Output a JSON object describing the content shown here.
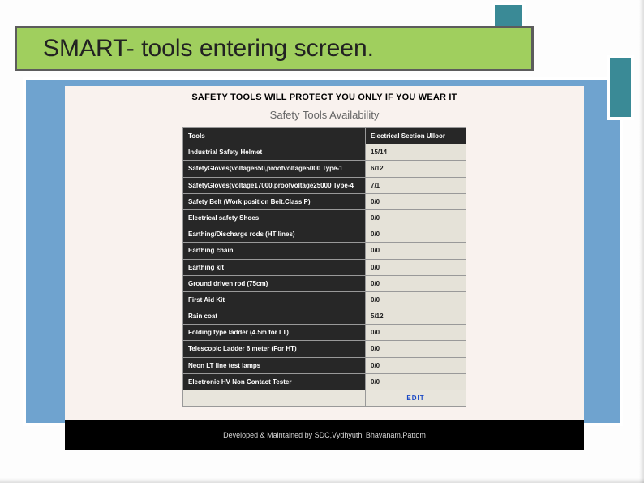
{
  "title": "SMART- tools entering screen.",
  "banner": "SAFETY TOOLS WILL PROTECT YOU ONLY IF YOU WEAR IT",
  "subhead": "Safety Tools Availability",
  "header": {
    "tools": "Tools",
    "section": "Electrical Section Ulloor"
  },
  "rows": [
    {
      "tool": "Industrial Safety Helmet",
      "val": "15/14"
    },
    {
      "tool": "SafetyGloves(voltage650,proofvoltage5000 Type-1",
      "val": "6/12"
    },
    {
      "tool": "SafetyGloves(voltage17000,proofvoltage25000 Type-4",
      "val": "7/1"
    },
    {
      "tool": "Safety Belt (Work position Belt.Class P)",
      "val": "0/0"
    },
    {
      "tool": "Electrical safety Shoes",
      "val": "0/0"
    },
    {
      "tool": "Earthing/Discharge rods (HT lines)",
      "val": "0/0"
    },
    {
      "tool": "Earthing chain",
      "val": "0/0"
    },
    {
      "tool": "Earthing kit",
      "val": "0/0"
    },
    {
      "tool": "Ground driven rod (75cm)",
      "val": "0/0"
    },
    {
      "tool": "First Aid Kit",
      "val": "0/0"
    },
    {
      "tool": "Rain coat",
      "val": "5/12"
    },
    {
      "tool": "Folding type ladder (4.5m for LT)",
      "val": "0/0"
    },
    {
      "tool": "Telescopic Ladder 6 meter (For HT)",
      "val": "0/0"
    },
    {
      "tool": "Neon LT line test lamps",
      "val": "0/0"
    },
    {
      "tool": "Electronic HV Non Contact Tester",
      "val": "0/0"
    }
  ],
  "edit": "EDIT",
  "footer": "Developed & Maintained by SDC,Vydhyuthi Bhavanam,Pattom"
}
